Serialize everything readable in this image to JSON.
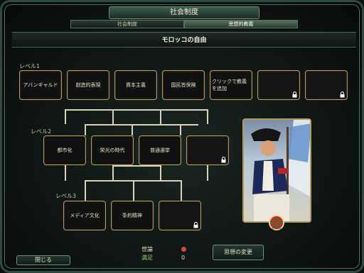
{
  "window": {
    "title": "社会制度"
  },
  "tabs": [
    {
      "label": "社会制度",
      "active": false
    },
    {
      "label": "思想的教義",
      "active": true
    }
  ],
  "ideology": {
    "name": "モロッコの自由"
  },
  "levels": [
    {
      "label": "レベル1",
      "tenets": [
        "アバンギャルド",
        "創造的表現",
        "資本主義",
        "国民皆保険",
        "クリックで教義を追加",
        "",
        ""
      ]
    },
    {
      "label": "レベル2",
      "tenets": [
        "都市化",
        "栄光の時代",
        "普通選挙",
        ""
      ]
    },
    {
      "label": "レベル3",
      "tenets": [
        "メディア文化",
        "条約精神",
        ""
      ]
    }
  ],
  "stats": {
    "opinion_label": "世論",
    "opinion_status": "満足",
    "opinion_value": "0"
  },
  "buttons": {
    "close": "閉じる",
    "change_ideology": "思想の変更"
  },
  "colors": {
    "accent_gold": "#b59c5a",
    "frame_green": "#4c6b5c",
    "satisfied": "#9fd86c"
  },
  "icons": [
    "lock-icon",
    "public-opinion-icon",
    "civ-emblem-icon"
  ]
}
